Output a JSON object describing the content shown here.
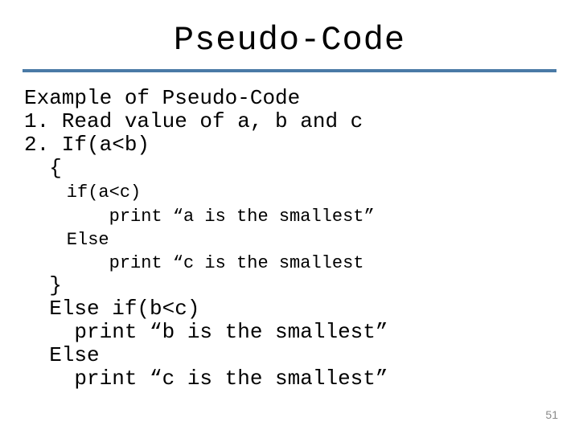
{
  "title": "Pseudo-Code",
  "line_example": "Example of Pseudo-Code",
  "line_1": "1. Read value of a, b and c",
  "line_2": "2. If(a<b)",
  "line_brace_open": "  {",
  "line_ifac": "    if(a<c)",
  "line_print_a": "        print “a is the smallest”",
  "line_else1": "    Else",
  "line_print_c1": "        print “c is the smallest",
  "line_brace_close": "  }",
  "line_elseif": "  Else if(b<c)",
  "line_print_b": "    print “b is the smallest”",
  "line_else2": "  Else",
  "line_print_c2": "    print “c is the smallest”",
  "page_number": "51"
}
